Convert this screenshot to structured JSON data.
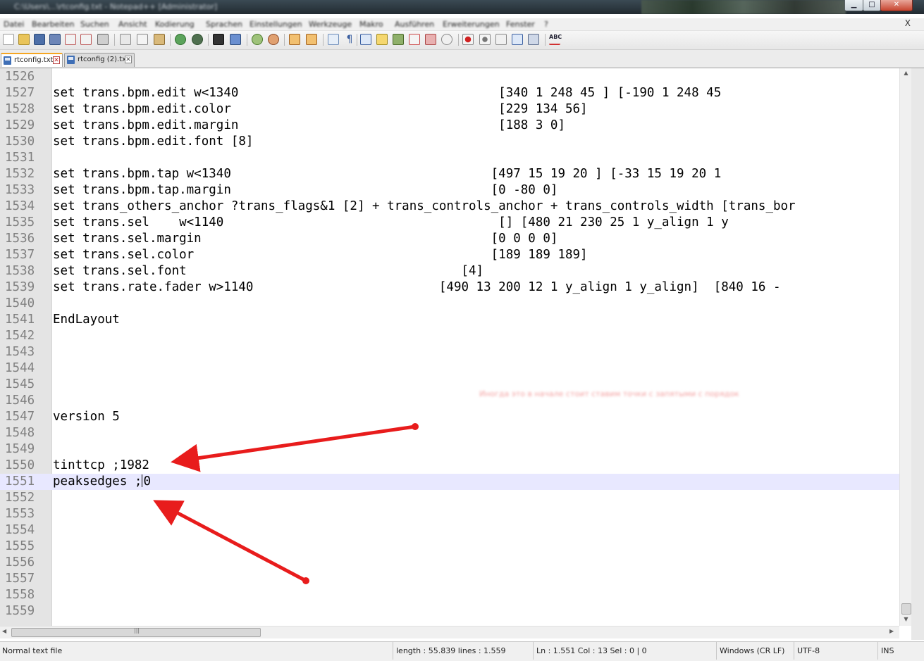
{
  "window": {
    "title": "C:\\Users\\...\\rtconfig.txt - Notepad++ [Administrator]",
    "controls": {
      "minimize": "▁",
      "maximize": "□",
      "close": "✕"
    }
  },
  "menu": {
    "items": [
      "Datei",
      "Bearbeiten",
      "Suchen",
      "Ansicht",
      "Kodierung",
      "Sprachen",
      "Einstellungen",
      "Werkzeuge",
      "Makro",
      "Ausführen",
      "Erweiterungen",
      "Fenster",
      "?"
    ],
    "close_doc": "X"
  },
  "toolbar": {
    "icons": [
      "new-file-icon",
      "open-file-icon",
      "save-icon",
      "save-all-icon",
      "close-icon",
      "close-all-icon",
      "print-icon",
      "cut-icon",
      "copy-icon",
      "paste-icon",
      "undo-icon",
      "redo-icon",
      "find-icon",
      "replace-icon",
      "zoom-in-icon",
      "zoom-out-icon",
      "sync-vertical-icon",
      "sync-horizontal-icon",
      "word-wrap-icon",
      "show-all-chars-icon",
      "indent-guide-icon",
      "user-lang-icon",
      "doc-map-icon",
      "function-list-icon",
      "folder-workspace-icon",
      "monitoring-icon",
      "record-macro-icon",
      "stop-record-icon",
      "play-macro-icon",
      "run-macro-multiple-icon",
      "save-macro-icon",
      "spell-check-icon"
    ],
    "spell_label": "ABC"
  },
  "tabs": [
    {
      "label": "rtconfig.txt",
      "active": true
    },
    {
      "label": "rtconfig (2).txt",
      "active": false
    }
  ],
  "editor": {
    "lines": [
      {
        "n": "1526",
        "text": ""
      },
      {
        "n": "1527",
        "text": "set trans.bpm.edit w<1340                                   [340 1 248 45 ] [-190 1 248 45"
      },
      {
        "n": "1528",
        "text": "set trans.bpm.edit.color                                    [229 134 56]"
      },
      {
        "n": "1529",
        "text": "set trans.bpm.edit.margin                                   [188 3 0]"
      },
      {
        "n": "1530",
        "text": "set trans.bpm.edit.font [8]"
      },
      {
        "n": "1531",
        "text": ""
      },
      {
        "n": "1532",
        "text": "set trans.bpm.tap w<1340                                   [497 15 19 20 ] [-33 15 19 20 1"
      },
      {
        "n": "1533",
        "text": "set trans.bpm.tap.margin                                   [0 -80 0]"
      },
      {
        "n": "1534",
        "text": "set trans_others_anchor ?trans_flags&1 [2] + trans_controls_anchor + trans_controls_width [trans_bor"
      },
      {
        "n": "1535",
        "text": "set trans.sel    w<1140                                     [] [480 21 230 25 1 y_align 1 y"
      },
      {
        "n": "1536",
        "text": "set trans.sel.margin                                       [0 0 0 0]"
      },
      {
        "n": "1537",
        "text": "set trans.sel.color                                        [189 189 189]"
      },
      {
        "n": "1538",
        "text": "set trans.sel.font                                     [4]"
      },
      {
        "n": "1539",
        "text": "set trans.rate.fader w>1140                         [490 13 200 12 1 y_align 1 y_align]  [840 16 -"
      },
      {
        "n": "1540",
        "text": ""
      },
      {
        "n": "1541",
        "text": "EndLayout"
      },
      {
        "n": "1542",
        "text": ""
      },
      {
        "n": "1543",
        "text": ""
      },
      {
        "n": "1544",
        "text": ""
      },
      {
        "n": "1545",
        "text": ""
      },
      {
        "n": "1546",
        "text": ""
      },
      {
        "n": "1547",
        "text": "version 5"
      },
      {
        "n": "1548",
        "text": ""
      },
      {
        "n": "1549",
        "text": ""
      },
      {
        "n": "1550",
        "text": "tinttcp ;1982"
      },
      {
        "n": "1551",
        "text_before_caret": "peaksedges ;",
        "text_after_caret": "0",
        "current": true
      },
      {
        "n": "1552",
        "text": ""
      },
      {
        "n": "1553",
        "text": ""
      },
      {
        "n": "1554",
        "text": ""
      },
      {
        "n": "1555",
        "text": ""
      },
      {
        "n": "1556",
        "text": ""
      },
      {
        "n": "1557",
        "text": ""
      },
      {
        "n": "1558",
        "text": ""
      },
      {
        "n": "1559",
        "text": ""
      }
    ],
    "annotation_note": "Иногда это в начале стоит ставим точки с запятыми с порядок",
    "annotation_color": "#e81c1c",
    "current_line_color": "#e8e8ff"
  },
  "statusbar": {
    "file_type": "Normal text file",
    "length_lines": "length : 55.839    lines : 1.559",
    "position": "Ln : 1.551    Col : 13    Sel : 0 | 0",
    "eol": "Windows (CR LF)",
    "encoding": "UTF-8",
    "mode": "INS"
  }
}
